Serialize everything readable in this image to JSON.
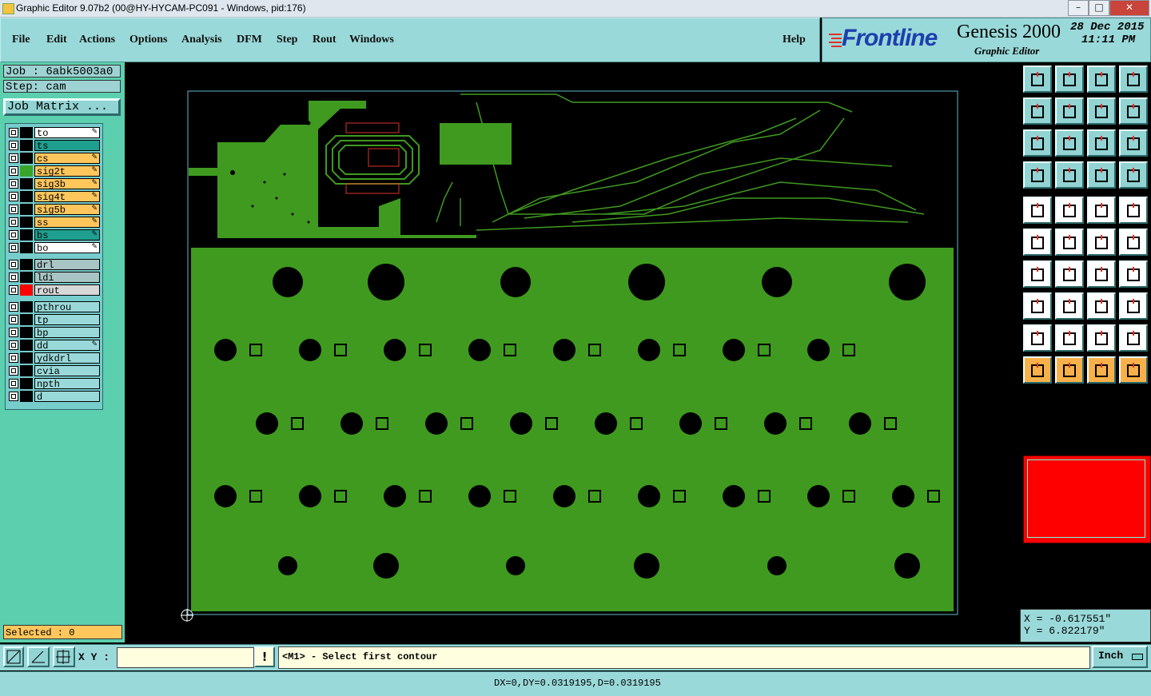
{
  "window": {
    "title": "Graphic Editor 9.07b2 (00@HY-HYCAM-PC091 - Windows, pid:176)"
  },
  "menubar": {
    "items": [
      "File",
      "Edit",
      "Actions",
      "Options",
      "Analysis",
      "DFM",
      "Step",
      "Rout",
      "Windows"
    ],
    "help": "Help"
  },
  "brand": {
    "logo": "Frontline",
    "product": "Genesis 2000",
    "subtitle": "Graphic Editor",
    "date": "28 Dec 2015",
    "time": "11:11 PM"
  },
  "job": {
    "job_line": "Job : 6abk5003a0",
    "step_line": "Step: cam",
    "matrix_button": "Job Matrix ..."
  },
  "layers": [
    {
      "name": "to",
      "fill": "#ffffff",
      "swatch": "#000000",
      "edit": true
    },
    {
      "name": "ts",
      "fill": "#1f9f8f",
      "swatch": "#000000",
      "edit": false
    },
    {
      "name": "cs",
      "fill": "#ffc65c",
      "swatch": "#000000",
      "edit": true
    },
    {
      "name": "sig2t",
      "fill": "#ffc65c",
      "swatch": "#3aa32a",
      "edit": true
    },
    {
      "name": "sig3b",
      "fill": "#ffc65c",
      "swatch": "#000000",
      "edit": true
    },
    {
      "name": "sig4t",
      "fill": "#ffc65c",
      "swatch": "#000000",
      "edit": true
    },
    {
      "name": "sig5b",
      "fill": "#ffc65c",
      "swatch": "#000000",
      "edit": true
    },
    {
      "name": "ss",
      "fill": "#ffc65c",
      "swatch": "#000000",
      "edit": true
    },
    {
      "name": "bs",
      "fill": "#1f9f8f",
      "swatch": "#000000",
      "edit": true
    },
    {
      "name": "bo",
      "fill": "#ffffff",
      "swatch": "#000000",
      "edit": true
    }
  ],
  "layers2": [
    {
      "name": "drl",
      "fill": "#a8c4c4",
      "swatch": "#000000"
    },
    {
      "name": "ldi",
      "fill": "#a8c4c4",
      "swatch": "#000000"
    },
    {
      "name": "rout",
      "fill": "#d8d8d8",
      "swatch": "#ff0000"
    }
  ],
  "layers3": [
    {
      "name": "pthrou",
      "fill": "#9ad9d9",
      "edit": false
    },
    {
      "name": "tp",
      "fill": "#9ad9d9",
      "edit": false
    },
    {
      "name": "bp",
      "fill": "#9ad9d9",
      "edit": false
    },
    {
      "name": "dd",
      "fill": "#9ad9d9",
      "edit": true
    },
    {
      "name": "ydkdrl",
      "fill": "#9ad9d9",
      "edit": false
    },
    {
      "name": "cvia",
      "fill": "#9ad9d9",
      "edit": false
    },
    {
      "name": "npth",
      "fill": "#9ad9d9",
      "edit": false
    },
    {
      "name": "d",
      "fill": "#9ad9d9",
      "edit": false
    }
  ],
  "status": {
    "selected": "Selected : 0",
    "prompt": "<M1> - Select first contour",
    "xy_label": "X Y :",
    "xy_value": "",
    "units": "Inch",
    "measure": "DX=0,DY=0.0319195,D=0.0319195"
  },
  "coords": {
    "x": "X = -0.617551\"",
    "y": "Y = 6.822179\""
  },
  "colors": {
    "board": "#3f9a1f",
    "panel_bg": "#9ad9d9",
    "accent": "#ffc65c"
  }
}
